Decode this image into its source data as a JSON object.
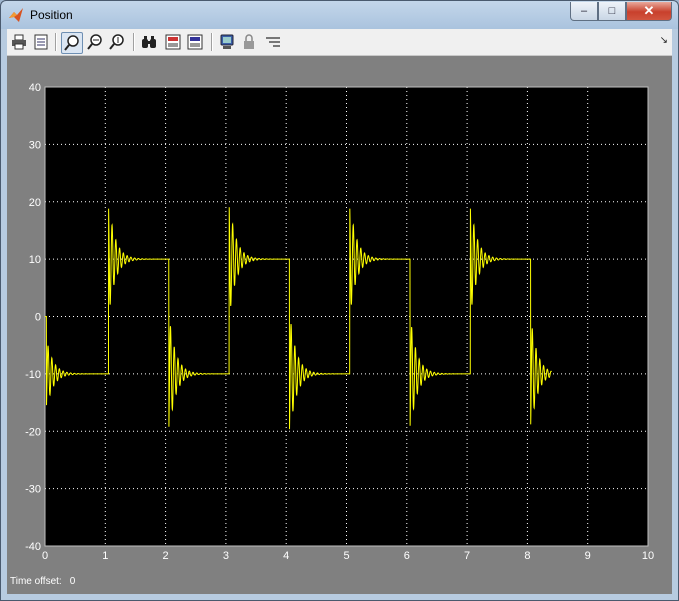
{
  "window": {
    "title": "Position",
    "controls": [
      "minimize",
      "maximize",
      "close"
    ]
  },
  "toolbar": {
    "buttons": [
      {
        "name": "print-icon",
        "tooltip": "Print"
      },
      {
        "name": "parameters-icon",
        "tooltip": "Parameters"
      },
      {
        "name": "zoom-icon",
        "tooltip": "Zoom",
        "active": true
      },
      {
        "name": "zoom-x-icon",
        "tooltip": "Zoom X-axis"
      },
      {
        "name": "zoom-y-icon",
        "tooltip": "Zoom Y-axis"
      },
      {
        "name": "autoscale-icon",
        "tooltip": "Autoscale"
      },
      {
        "name": "save-axes-icon",
        "tooltip": "Save axes settings"
      },
      {
        "name": "restore-axes-icon",
        "tooltip": "Restore saved axes settings"
      },
      {
        "name": "floating-scope-icon",
        "tooltip": "Floating scope"
      },
      {
        "name": "lock-icon",
        "tooltip": "Lock axes selection"
      },
      {
        "name": "signal-selection-icon",
        "tooltip": "Signal selection"
      }
    ]
  },
  "status": {
    "time_offset_label": "Time offset:",
    "time_offset_value": "0"
  },
  "colors": {
    "plot_background": "#000000",
    "trace": "#ffff00",
    "grid": "#ffffff",
    "figure_background": "#808080"
  },
  "chart_data": {
    "type": "line",
    "title": "",
    "xlabel": "",
    "ylabel": "",
    "xlim": [
      0,
      10
    ],
    "ylim": [
      -40,
      40
    ],
    "grid": true,
    "xticks": [
      "0",
      "1",
      "2",
      "3",
      "4",
      "5",
      "6",
      "7",
      "8",
      "9",
      "10"
    ],
    "yticks": [
      "-40",
      "-30",
      "-20",
      "-10",
      "0",
      "10",
      "20",
      "30",
      "40"
    ],
    "series": [
      {
        "color": "#ffff00",
        "description": "square-wave step response toggling between -10 and 10 every 1 s with decaying oscillation after each step, ending near t=8.4",
        "x": [
          0,
          0.05,
          0.3,
          1.0,
          1.05,
          1.1,
          1.15,
          1.3,
          1.5,
          2.0,
          2.05,
          2.1,
          2.15,
          2.3,
          2.5,
          3.0,
          3.05,
          3.1,
          3.15,
          3.3,
          3.5,
          4.0,
          4.05,
          4.1,
          4.15,
          4.3,
          4.5,
          5.0,
          5.05,
          5.1,
          5.15,
          5.3,
          5.5,
          6.0,
          6.05,
          6.1,
          6.15,
          6.3,
          6.5,
          7.0,
          7.05,
          7.1,
          7.15,
          7.3,
          7.5,
          8.0,
          8.05,
          8.1,
          8.15,
          8.4
        ],
        "y": [
          0,
          -16.5,
          -10,
          -10,
          0,
          20.5,
          3.5,
          12,
          10,
          10,
          0,
          -21,
          -3,
          -12,
          -10,
          -10,
          0,
          20.8,
          3,
          12,
          10,
          10,
          0,
          -21.5,
          -3,
          -12,
          -10,
          -10,
          0,
          20.5,
          3.5,
          12,
          10,
          10,
          0,
          -20.8,
          -3.5,
          -12,
          -10,
          -10,
          0,
          20.5,
          3.5,
          12,
          10,
          10,
          0,
          -20.5,
          -3.5,
          -10
        ]
      }
    ]
  }
}
